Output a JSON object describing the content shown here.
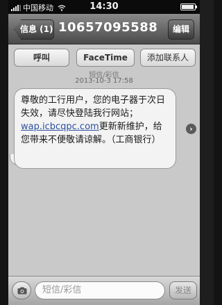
{
  "status_bar": {
    "carrier": "中国移动",
    "time": "14:30"
  },
  "nav": {
    "back_label": "信息 (1)",
    "title": "10657095588",
    "edit_label": "编辑"
  },
  "actions": {
    "call_label": "呼叫",
    "facetime_label": "FaceTime",
    "add_contact_label": "添加联系人"
  },
  "conversation": {
    "meta_label": "短信/彩信",
    "date": "2013-10-3 17:58",
    "message": {
      "part1": "尊敬的工行用户，您的电子器于次日失效，请尽快登陆我行网站；",
      "link": "wap.icbcqpc.com",
      "part2": "更新新维护，给您带来不便敬请谅解。（工商银行）"
    }
  },
  "input_bar": {
    "placeholder": "短信/彩信",
    "send_label": "发送"
  },
  "icons": {
    "detail": "chevron-right-icon",
    "camera": "camera-icon",
    "signal": "signal-icon",
    "wifi": "wifi-icon",
    "battery": "battery-icon"
  },
  "colors": {
    "link": "#2a4f9e",
    "bubble": "#f3f3f3",
    "nav_bar": "#5a5a5a"
  }
}
